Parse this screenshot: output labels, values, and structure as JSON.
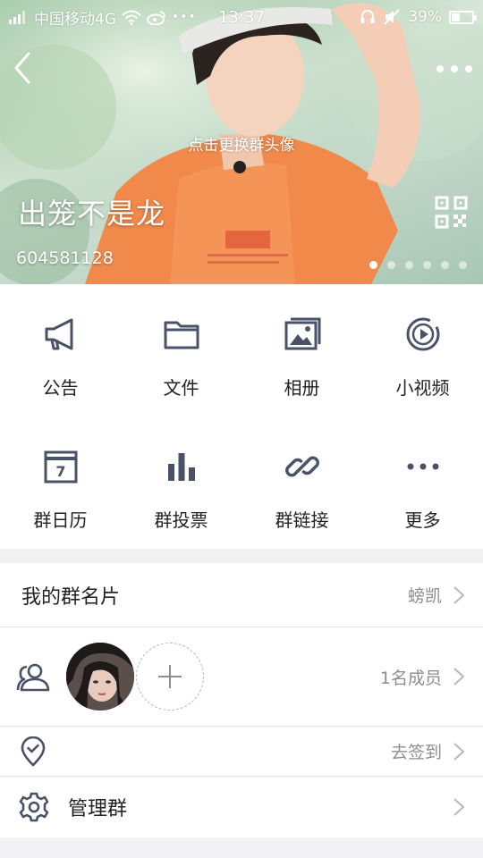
{
  "status_bar": {
    "carrier": "中国移动4G",
    "time": "13:37",
    "battery": "39%",
    "battery_level": 0.39
  },
  "header": {
    "change_avatar_hint": "点击更换群头像",
    "group_name": "出笼不是龙",
    "group_id": "604581128",
    "page_count": 6,
    "active_page": 1
  },
  "grid": [
    {
      "label": "公告",
      "icon": "megaphone-icon"
    },
    {
      "label": "文件",
      "icon": "folder-icon"
    },
    {
      "label": "相册",
      "icon": "album-icon"
    },
    {
      "label": "小视频",
      "icon": "video-icon"
    },
    {
      "label": "群日历",
      "icon": "calendar-icon",
      "calendar_day": "7"
    },
    {
      "label": "群投票",
      "icon": "vote-chart-icon"
    },
    {
      "label": "群链接",
      "icon": "link-icon"
    },
    {
      "label": "更多",
      "icon": "more-dots-icon"
    }
  ],
  "list": {
    "card": {
      "title": "我的群名片",
      "value": "螃凯"
    },
    "members": {
      "value": "1名成员"
    },
    "checkin": {
      "value": "去签到"
    },
    "manage": {
      "title": "管理群"
    }
  },
  "colors": {
    "icon": "#4a5267",
    "secondary_text": "#8d8d93",
    "page_bg": "#f2f2f4"
  }
}
